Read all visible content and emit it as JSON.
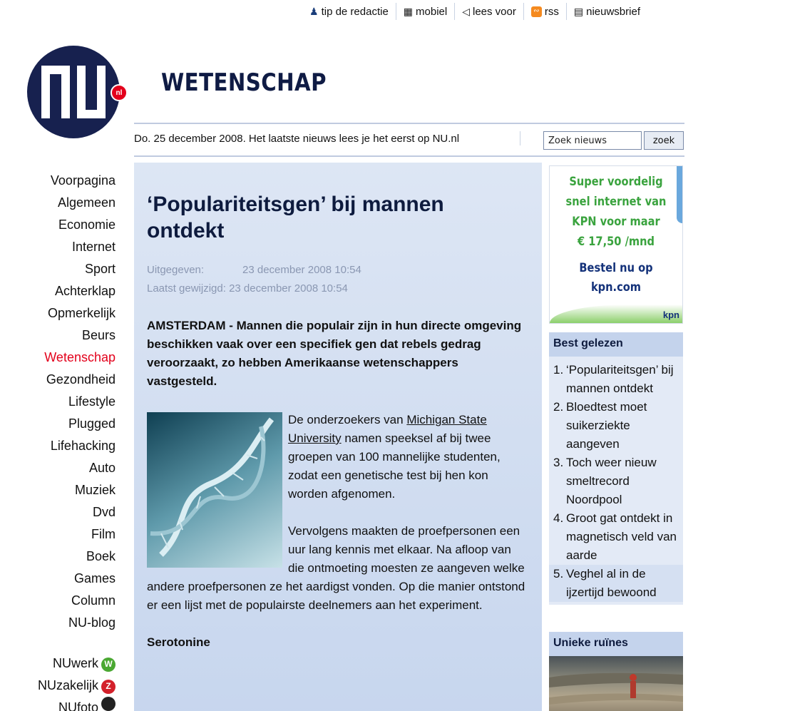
{
  "top_links": [
    {
      "icon": "person-icon",
      "label": "tip de redactie"
    },
    {
      "icon": "mobile-icon",
      "label": "mobiel"
    },
    {
      "icon": "speaker-icon",
      "label": "lees voor"
    },
    {
      "icon": "rss-icon",
      "label": "rss"
    },
    {
      "icon": "newsletter-icon",
      "label": "nieuwsbrief"
    }
  ],
  "logo": {
    "text": "NU",
    "suffix": "nl",
    "navy": "#17214f",
    "red": "#e3001b"
  },
  "section_title": "WETENSCHAP",
  "date_line": "Do. 25 december 2008. Het laatste nieuws lees je het eerst op NU.nl",
  "search": {
    "value": "Zoek nieuws",
    "button": "zoek"
  },
  "nav": {
    "items": [
      "Voorpagina",
      "Algemeen",
      "Economie",
      "Internet",
      "Sport",
      "Achterklap",
      "Opmerkelijk",
      "Beurs",
      "Wetenschap",
      "Gezondheid",
      "Lifestyle",
      "Plugged",
      "Lifehacking",
      "Auto",
      "Muziek",
      "Dvd",
      "Film",
      "Boek",
      "Games",
      "Column",
      "NU-blog"
    ],
    "active": "Wetenschap",
    "extra": [
      {
        "label": "NUwerk",
        "badge": "W",
        "color": "#4aa832"
      },
      {
        "label": "NUzakelijk",
        "badge": "Z",
        "color": "#d3202a"
      },
      {
        "label": "NUfoto",
        "badge": "",
        "color": "#222222"
      }
    ]
  },
  "article": {
    "title": "‘Populariteitsgen’ bij mannen ontdekt",
    "published_label": "Uitgegeven:",
    "published": "23 december 2008 10:54",
    "modified_label": "Laatst gewijzigd:",
    "modified": "23 december 2008 10:54",
    "lead": "AMSTERDAM - Mannen die populair zijn in hun directe omgeving beschikken vaak over een specifiek gen dat rebels gedrag veroorzaakt, zo hebben Amerikaanse wetenschappers vastgesteld.",
    "p1_before": "De onderzoekers van ",
    "p1_link": "Michigan State University",
    "p1_after": " namen speeksel af bij twee groepen van 100 mannelijke studenten, zodat een genetische test bij hen kon worden afgenomen.",
    "p2": "Vervolgens maakten de proefpersonen een uur lang kennis met elkaar. Na afloop van die ontmoeting moesten ze aangeven welke andere proefpersonen ze het aardigst vonden. Op die manier ontstond er een lijst met de populairste deelnemers aan het experiment.",
    "subhead": "Serotonine"
  },
  "ad": {
    "line1": "Super voordelig",
    "line2": "snel internet van",
    "line3": "KPN voor maar",
    "line4": "€ 17,50 /mnd",
    "cta1": "Bestel nu op",
    "cta2": "kpn.com",
    "brand": "kpn"
  },
  "best_gelezen": {
    "title": "Best gelezen",
    "items": [
      {
        "num": "1.",
        "text": "‘Populariteitsgen’ bij mannen ontdekt"
      },
      {
        "num": "2.",
        "text": "Bloedtest moet suikerziekte aangeven"
      },
      {
        "num": "3.",
        "text": "Toch weer nieuw smeltrecord Noordpool"
      },
      {
        "num": "4.",
        "text": "Groot gat ontdekt in magnetisch veld van aarde"
      },
      {
        "num": "5.",
        "text": "Veghel al in de ijzertijd bewoond"
      }
    ]
  },
  "unieke_ruines": {
    "title": "Unieke ruïnes"
  }
}
